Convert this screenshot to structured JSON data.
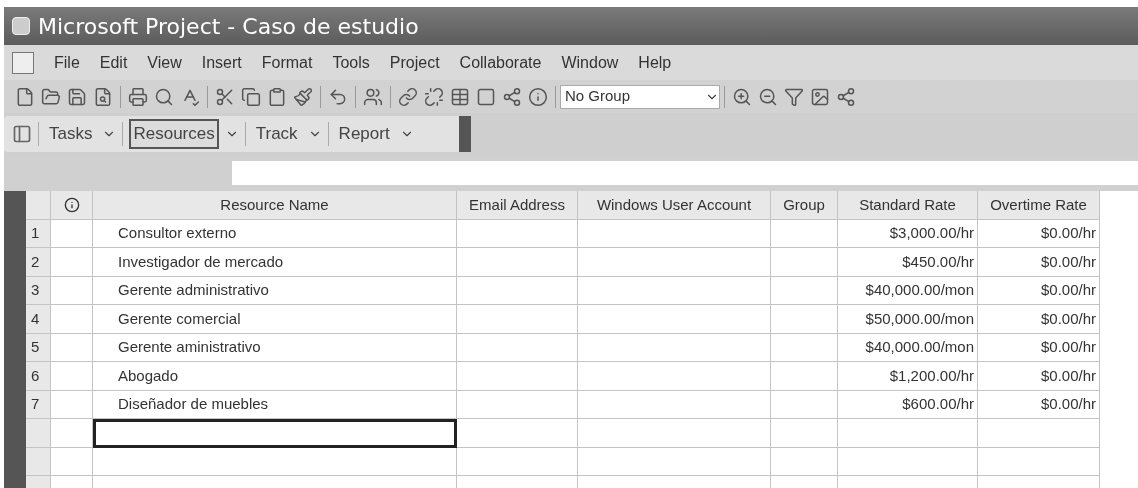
{
  "window": {
    "title": "Microsoft Project - Caso de estudio"
  },
  "menu": [
    "File",
    "Edit",
    "View",
    "Insert",
    "Format",
    "Tools",
    "Project",
    "Collaborate",
    "Window",
    "Help"
  ],
  "toolbar": {
    "group_dropdown": "No Group"
  },
  "guide_toolbar": [
    {
      "label": "Tasks",
      "selected": false
    },
    {
      "label": "Resources",
      "selected": true
    },
    {
      "label": "Track",
      "selected": false
    },
    {
      "label": "Report",
      "selected": false
    }
  ],
  "table": {
    "columns": [
      "Resource Name",
      "Email Address",
      "Windows User Account",
      "Group",
      "Standard Rate",
      "Overtime Rate"
    ],
    "rows": [
      {
        "id": "1",
        "name": "Consultor externo",
        "standard_rate": "$3,000.00/hr",
        "overtime_rate": "$0.00/hr"
      },
      {
        "id": "2",
        "name": "Investigador de mercado",
        "standard_rate": "$450.00/hr",
        "overtime_rate": "$0.00/hr"
      },
      {
        "id": "3",
        "name": "Gerente administrativo",
        "standard_rate": "$40,000.00/mon",
        "overtime_rate": "$0.00/hr"
      },
      {
        "id": "4",
        "name": "Gerente comercial",
        "standard_rate": "$50,000.00/mon",
        "overtime_rate": "$0.00/hr"
      },
      {
        "id": "5",
        "name": "Gerente aministrativo",
        "standard_rate": "$40,000.00/mon",
        "overtime_rate": "$0.00/hr"
      },
      {
        "id": "6",
        "name": "Abogado",
        "standard_rate": "$1,200.00/hr",
        "overtime_rate": "$0.00/hr"
      },
      {
        "id": "7",
        "name": "Diseñador de muebles",
        "standard_rate": "$600.00/hr",
        "overtime_rate": "$0.00/hr"
      }
    ],
    "empty_rows": [
      {
        "selected": true
      },
      {
        "selected": false
      },
      {
        "selected": false
      }
    ]
  }
}
